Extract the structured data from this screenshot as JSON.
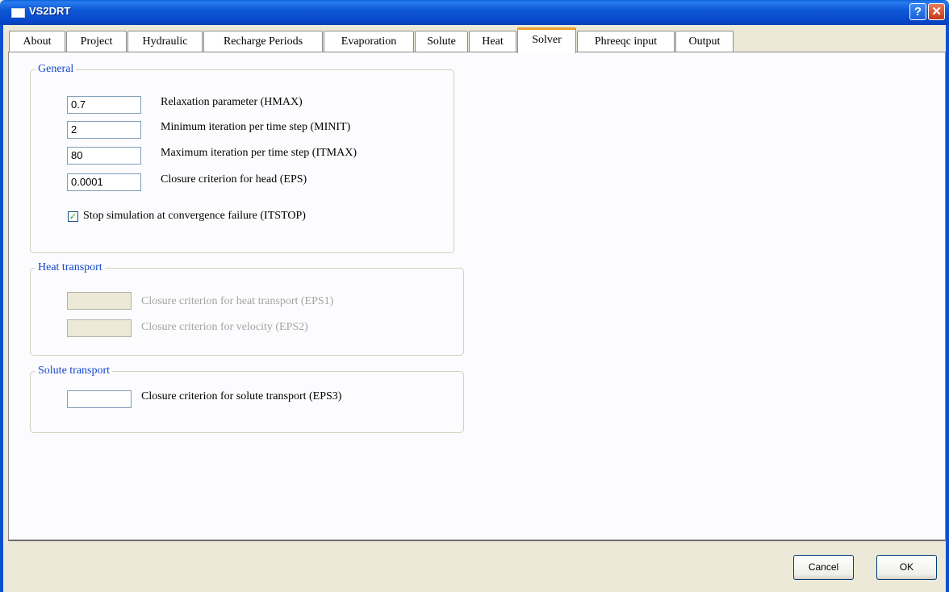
{
  "window": {
    "title": "VS2DRT",
    "help_label": "?",
    "close_label": "✕"
  },
  "tabs": [
    {
      "label": "About"
    },
    {
      "label": "Project"
    },
    {
      "label": "Hydraulic"
    },
    {
      "label": "Recharge Periods"
    },
    {
      "label": "Evaporation"
    },
    {
      "label": "Solute"
    },
    {
      "label": "Heat"
    },
    {
      "label": "Solver"
    },
    {
      "label": "Phreeqc input"
    },
    {
      "label": "Output"
    }
  ],
  "active_tab": "Solver",
  "general": {
    "title": "General",
    "hmax": {
      "value": "0.7",
      "label": "Relaxation parameter  (HMAX)"
    },
    "minit": {
      "value": "2",
      "label": "Minimum iteration per time step (MINIT)"
    },
    "itmax": {
      "value": "80",
      "label": "Maximum iteration per time step (ITMAX)"
    },
    "eps": {
      "value": "0.0001",
      "label": "Closure criterion for head (EPS)"
    },
    "itstop": {
      "checked": true,
      "check_mark": "✓",
      "label": "Stop simulation at convergence failure (ITSTOP)"
    }
  },
  "heat_transport": {
    "title": "Heat transport",
    "eps1": {
      "value": "",
      "label": "Closure criterion for heat transport (EPS1)"
    },
    "eps2": {
      "value": "",
      "label": "Closure criterion for velocity (EPS2)"
    }
  },
  "solute_transport": {
    "title": "Solute transport",
    "eps3": {
      "value": "",
      "label": "Closure criterion for solute transport (EPS3)"
    }
  },
  "buttons": {
    "cancel": "Cancel",
    "ok": "OK"
  },
  "colors": {
    "titlebar": "#0a52d0",
    "legend_text": "#1446c8",
    "active_tab_accent": "#f0a030",
    "dialog_background": "#ece9d8"
  }
}
